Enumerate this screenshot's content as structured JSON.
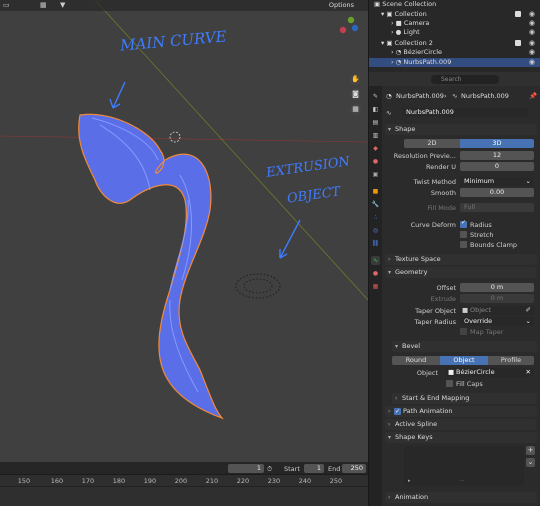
{
  "viewport": {
    "options_label": "Options",
    "annotations": {
      "main_curve": "MAIN CURVE",
      "extrusion_line1": "EXTRUSION",
      "extrusion_line2": "OBJECT"
    },
    "nav_icons": [
      "hand-icon",
      "camera-icon",
      "grid-icon"
    ]
  },
  "timeline": {
    "current_frame": "1",
    "start_label": "Start",
    "start_value": "1",
    "end_label": "End",
    "end_value": "250",
    "ticks": [
      "150",
      "160",
      "170",
      "180",
      "190",
      "200",
      "210",
      "220",
      "230",
      "240",
      "250"
    ]
  },
  "outliner": {
    "rows": [
      {
        "label": "Scene Collection"
      },
      {
        "label": "Collection"
      },
      {
        "label": "Camera"
      },
      {
        "label": "Light"
      },
      {
        "label": "Collection 2"
      },
      {
        "label": "BézierCircle"
      },
      {
        "label": "NurbsPath.009"
      }
    ],
    "search_placeholder": "Search"
  },
  "properties": {
    "breadcrumb_object": "NurbsPath.009",
    "breadcrumb_data": "NurbsPath.009",
    "datablock_name": "NurbsPath.009",
    "shape": {
      "title": "Shape",
      "mode_2d": "2D",
      "mode_3d": "3D",
      "resolution_preview_label": "Resolution Previe...",
      "resolution_preview_value": "12",
      "render_u_label": "Render U",
      "render_u_value": "0",
      "twist_method_label": "Twist Method",
      "twist_method_value": "Minimum",
      "smooth_label": "Smooth",
      "smooth_value": "0.00",
      "fill_mode_label": "Fill Mode",
      "fill_mode_value": "Full",
      "curve_deform_label": "Curve Deform",
      "radius_label": "Radius",
      "stretch_label": "Stretch",
      "bounds_clamp_label": "Bounds Clamp"
    },
    "texture_space_title": "Texture Space",
    "geometry": {
      "title": "Geometry",
      "offset_label": "Offset",
      "offset_value": "0 m",
      "extrude_label": "Extrude",
      "extrude_value": "0 m",
      "taper_object_label": "Taper Object",
      "taper_object_placeholder": "Object",
      "taper_radius_label": "Taper Radius",
      "taper_radius_value": "Override",
      "map_taper_label": "Map Taper"
    },
    "bevel": {
      "title": "Bevel",
      "round": "Round",
      "object": "Object",
      "profile": "Profile",
      "object_label": "Object",
      "object_value": "BézierCircle",
      "fill_caps_label": "Fill Caps"
    },
    "start_end_mapping_title": "Start & End Mapping",
    "path_animation_title": "Path Animation",
    "active_spline_title": "Active Spline",
    "shape_keys_title": "Shape Keys",
    "animation_title": "Animation"
  }
}
